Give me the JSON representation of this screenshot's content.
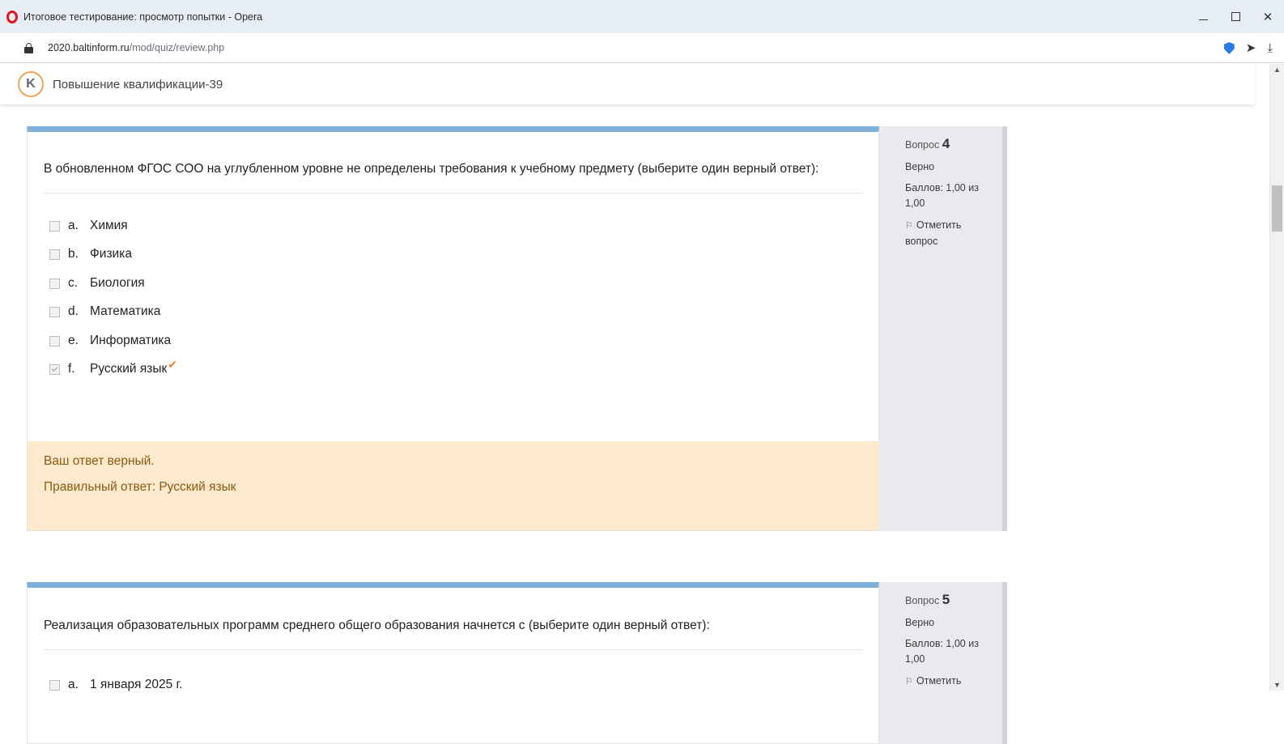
{
  "window": {
    "title": "Итоговое тестирование: просмотр попытки - Opera",
    "controls": {
      "minimize": "",
      "maximize": "",
      "close": "✕"
    }
  },
  "address_bar": {
    "host_prefix": "2020.",
    "host": "baltinform.ru",
    "path": "/mod/quiz/review.php"
  },
  "site": {
    "logo_glyph": "K",
    "name": "Повышение квалификации-39"
  },
  "questions": [
    {
      "number_label": "Вопрос",
      "number": "4",
      "state": "Верно",
      "grade": "Баллов: 1,00 из 1,00",
      "flag": "Отметить вопрос",
      "text": "В обновленном ФГОС СОО на углубленном уровне не определены требования к учебному предмету (выберите один верный ответ):",
      "answers": [
        {
          "letter": "a.",
          "label": "Химия",
          "checked": false
        },
        {
          "letter": "b.",
          "label": "Физика",
          "checked": false
        },
        {
          "letter": "c.",
          "label": "Биология",
          "checked": false
        },
        {
          "letter": "d.",
          "label": "Математика",
          "checked": false
        },
        {
          "letter": "e.",
          "label": "Информатика",
          "checked": false
        },
        {
          "letter": "f.",
          "label": "Русский язык",
          "checked": true
        }
      ],
      "feedback": {
        "result": "Ваш ответ верный.",
        "right_answer": "Правильный ответ: Русский язык"
      }
    },
    {
      "number_label": "Вопрос",
      "number": "5",
      "state": "Верно",
      "grade": "Баллов: 1,00 из 1,00",
      "flag": "Отметить",
      "text": "Реализация образовательных программ среднего общего образования начнется с (выберите один верный ответ):",
      "answers": [
        {
          "letter": "a.",
          "label": "1 января 2025 г.",
          "checked": false
        }
      ]
    }
  ],
  "colors": {
    "question_top_border": "#7fb0d9",
    "feedback_bg": "#fde9cc",
    "feedback_text": "#8a5a13",
    "correct_mark": "#f0812f",
    "opera_red": "#e3141c"
  }
}
